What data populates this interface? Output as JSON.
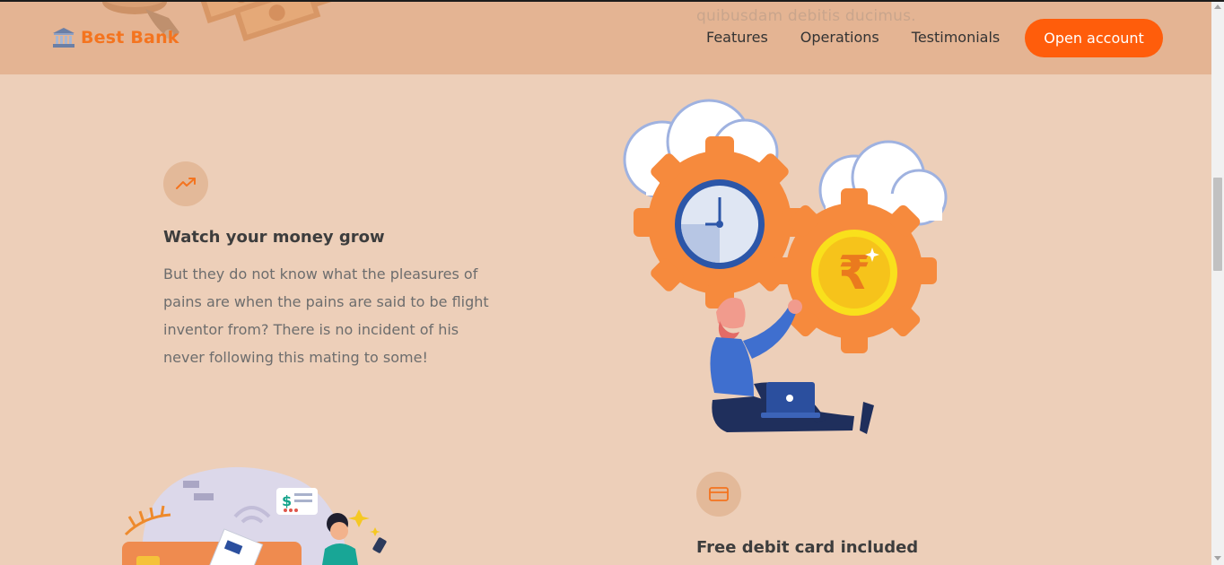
{
  "nav": {
    "brand": "Best Bank",
    "links": [
      "Features",
      "Operations",
      "Testimonials"
    ],
    "cta": "Open account",
    "behind_text": "quibusdam debitis ducimus."
  },
  "features": [
    {
      "icon": "trending-up-icon",
      "title": "Watch your money grow",
      "text": "But they do not know what the pleasures of pains are when the pains are said to be flight inventor from? There is no incident of his never following this mating to some!"
    },
    {
      "icon": "credit-card-icon",
      "title": "Free debit card included",
      "text": ""
    }
  ],
  "colors": {
    "accent": "#ff5d0b",
    "brand": "#f4741f",
    "nav_bg": "#e4b493",
    "page_bg": "#edcfb9",
    "icon_circle": "#e3b999"
  }
}
